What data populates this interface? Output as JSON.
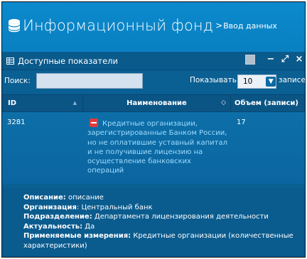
{
  "header": {
    "app_title": "Информационный фонд",
    "separator": ">",
    "breadcrumb": "Ввод данных"
  },
  "panel": {
    "title": "Доступные показатели",
    "controls": {
      "minimize": "−",
      "expand": "⤢",
      "close": "×"
    }
  },
  "filter": {
    "search_label": "Поиск:",
    "search_value": "",
    "show_label": "Показывать",
    "page_size": "10",
    "records_label": "записей"
  },
  "table": {
    "columns": [
      "ID",
      "Наименование",
      "Объем (записи)"
    ],
    "rows": [
      {
        "id": "3281",
        "name": "Кредитные организации, зарегистрированные Банком России, но не оплатившие уставный капитал и не получившие лицензию на осуществление банковских операций",
        "volume": "17"
      }
    ]
  },
  "details": {
    "description_label": "Описание:",
    "description_value": "описание",
    "organization_label": "Организация",
    "organization_value": "Центральный банк",
    "division_label": "Подразделение:",
    "division_value": "Департамента лицензирования деятельности",
    "actuality_label": "Актуальность:",
    "actuality_value": "Да",
    "dimensions_label": "Применяемые измерения:",
    "dimensions_value": "Кредитные организации (количественные характеристики)"
  },
  "colors": {
    "header_bg": "#0b8acd",
    "panel_bg": "#0a5f93",
    "link": "#9fdcff",
    "minus": "#e03b3b"
  }
}
